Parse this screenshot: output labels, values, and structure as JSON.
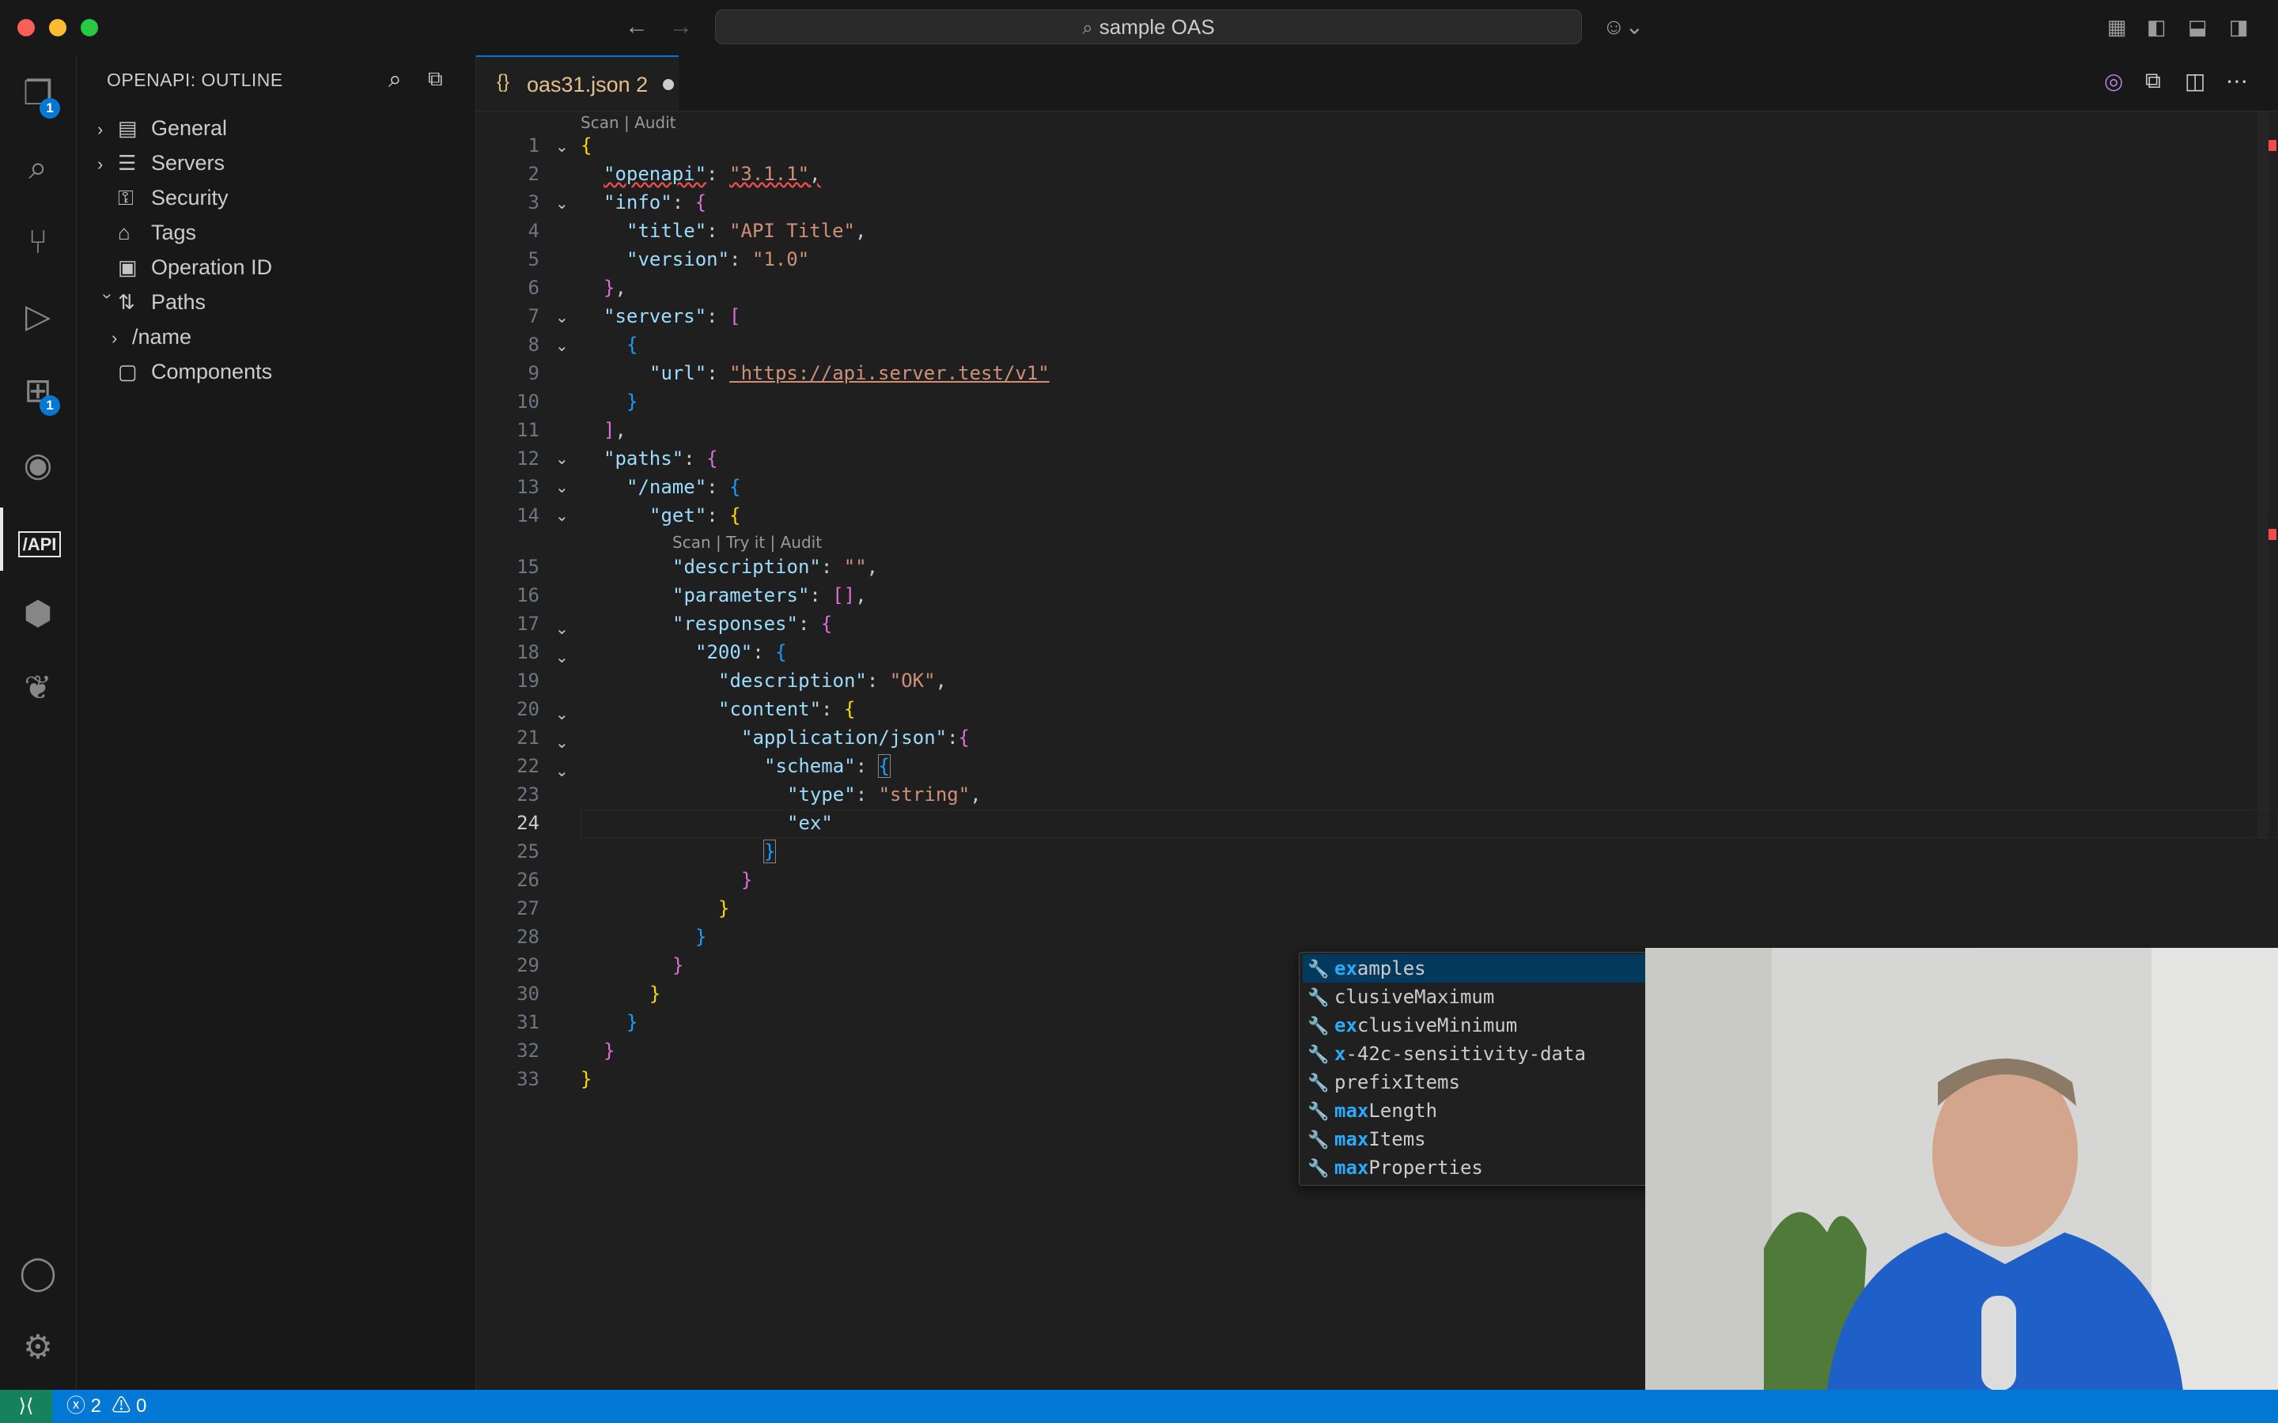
{
  "window": {
    "title": "sample OAS"
  },
  "activity_bar": {
    "explorer_badge": "1",
    "extensions_badge": "1",
    "api_label": "/API"
  },
  "sidebar": {
    "title": "OPENAPI: OUTLINE",
    "items": [
      {
        "label": "General",
        "icon": "document-icon",
        "expandable": true
      },
      {
        "label": "Servers",
        "icon": "server-icon",
        "expandable": true
      },
      {
        "label": "Security",
        "icon": "key-icon",
        "expandable": false
      },
      {
        "label": "Tags",
        "icon": "tag-icon",
        "expandable": false
      },
      {
        "label": "Operation ID",
        "icon": "id-card-icon",
        "expandable": false
      },
      {
        "label": "Paths",
        "icon": "paths-icon",
        "expandable": true,
        "expanded": true
      },
      {
        "label": "/name",
        "icon": "",
        "expandable": true
      },
      {
        "label": "Components",
        "icon": "box-icon",
        "expandable": false
      }
    ]
  },
  "tab": {
    "label": "oas31.json 2",
    "icon_glyph": "{}"
  },
  "codelens": {
    "top": "Scan | Audit",
    "get": "Scan | Try it | Audit"
  },
  "code": {
    "l1": "{",
    "l2k": "\"openapi\"",
    "l2v": "\"3.1.1\"",
    "l3k": "\"info\"",
    "l4k": "\"title\"",
    "l4v": "\"API Title\"",
    "l5k": "\"version\"",
    "l5v": "\"1.0\"",
    "l7k": "\"servers\"",
    "l9k": "\"url\"",
    "l9v": "\"https://api.server.test/v1\"",
    "l12k": "\"paths\"",
    "l13k": "\"/name\"",
    "l14k": "\"get\"",
    "l15k": "\"description\"",
    "l15v": "\"\"",
    "l16k": "\"parameters\"",
    "l17k": "\"responses\"",
    "l18k": "\"200\"",
    "l19k": "\"description\"",
    "l19v": "\"OK\"",
    "l20k": "\"content\"",
    "l21k": "\"application/json\"",
    "l22k": "\"schema\"",
    "l23k": "\"type\"",
    "l23v": "\"string\"",
    "l24": "\"ex\""
  },
  "line_numbers": [
    "1",
    "2",
    "3",
    "4",
    "5",
    "6",
    "7",
    "8",
    "9",
    "10",
    "11",
    "12",
    "13",
    "14",
    "15",
    "16",
    "17",
    "18",
    "19",
    "20",
    "21",
    "22",
    "23",
    "24",
    "25",
    "26",
    "27",
    "28",
    "29",
    "30",
    "31",
    "32",
    "33"
  ],
  "suggestions": [
    {
      "match": "ex",
      "rest": "amples",
      "selected": true
    },
    {
      "match": "",
      "rest": "clusiveMaximum",
      "selected": false
    },
    {
      "match": "ex",
      "rest": "clusiveMinimum",
      "selected": false
    },
    {
      "match": "x",
      "rest": "-42c-sensitivity-data",
      "selected": false
    },
    {
      "match": "",
      "rest": "prefixItems",
      "selected": false
    },
    {
      "match": "max",
      "rest": "Length",
      "selected": false
    },
    {
      "match": "max",
      "rest": "Items",
      "selected": false
    },
    {
      "match": "max",
      "rest": "Properties",
      "selected": false
    }
  ],
  "status": {
    "errors": "2",
    "warnings": "0"
  },
  "colors": {
    "accent": "#0078d4",
    "status_bar": "#0078d4",
    "remote": "#16825d"
  }
}
